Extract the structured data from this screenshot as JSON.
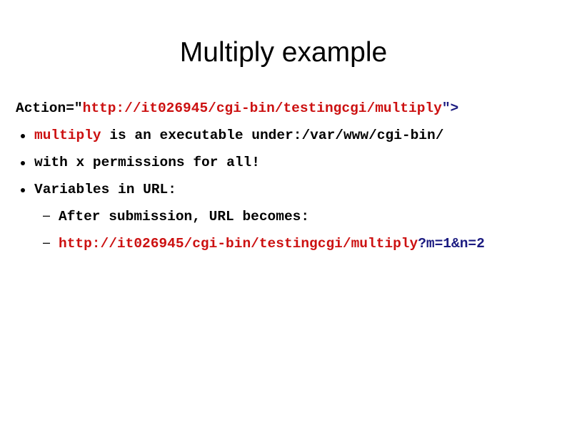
{
  "title": "Multiply example",
  "action_line": {
    "prefix": "Action=\"",
    "url": "http://it026945/cgi-bin/testingcgi/multiply",
    "suffix": "\">"
  },
  "bullets": [
    {
      "highlight": "multiply",
      "text": " is an executable under:/var/www/cgi-bin/"
    },
    {
      "text": "with x permissions for all!"
    },
    {
      "text": "Variables in URL:"
    }
  ],
  "sub_bullets": [
    {
      "text": "After submission, URL becomes:"
    },
    {
      "url": "http://it026945/cgi-bin/testingcgi/multiply",
      "query": "?m=1&n=2"
    }
  ],
  "colors": {
    "highlight": "#cc1111",
    "query": "#1a1a80"
  }
}
